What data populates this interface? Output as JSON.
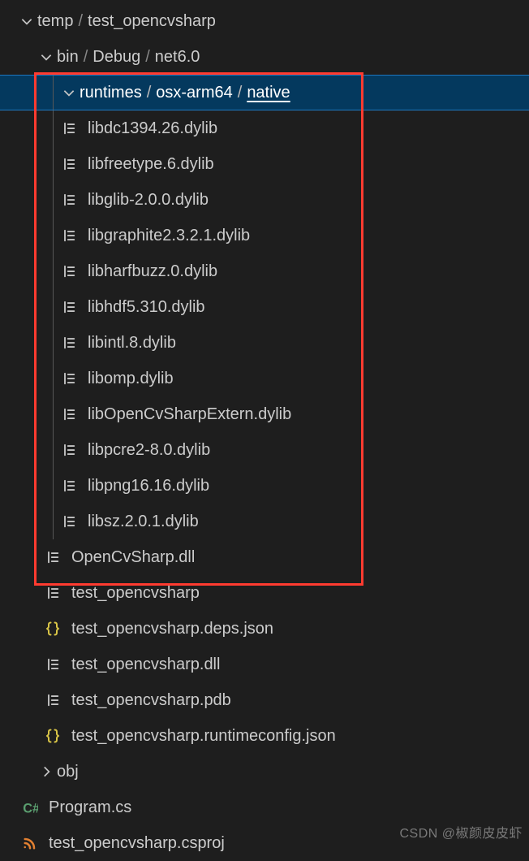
{
  "root": {
    "name": "temp",
    "sep": "/",
    "child": "test_opencvsharp"
  },
  "bin": {
    "segs": [
      "bin",
      "Debug",
      "net6.0"
    ]
  },
  "runtimes": {
    "segs": [
      "runtimes",
      "osx-arm64",
      "native"
    ]
  },
  "native_files": [
    "libdc1394.26.dylib",
    "libfreetype.6.dylib",
    "libglib-2.0.0.dylib",
    "libgraphite2.3.2.1.dylib",
    "libharfbuzz.0.dylib",
    "libhdf5.310.dylib",
    "libintl.8.dylib",
    "libomp.dylib",
    "libOpenCvSharpExtern.dylib",
    "libpcre2-8.0.dylib",
    "libpng16.16.dylib",
    "libsz.2.0.1.dylib"
  ],
  "bin_files": [
    {
      "name": "OpenCvSharp.dll",
      "icon": "lines"
    },
    {
      "name": "test_opencvsharp",
      "icon": "lines"
    },
    {
      "name": "test_opencvsharp.deps.json",
      "icon": "braces"
    },
    {
      "name": "test_opencvsharp.dll",
      "icon": "lines"
    },
    {
      "name": "test_opencvsharp.pdb",
      "icon": "lines"
    },
    {
      "name": "test_opencvsharp.runtimeconfig.json",
      "icon": "braces"
    }
  ],
  "obj": {
    "name": "obj"
  },
  "root_files": [
    {
      "name": "Program.cs",
      "icon": "cs"
    },
    {
      "name": "test_opencvsharp.csproj",
      "icon": "rss"
    }
  ],
  "watermark": "CSDN @椒颜皮皮虾"
}
